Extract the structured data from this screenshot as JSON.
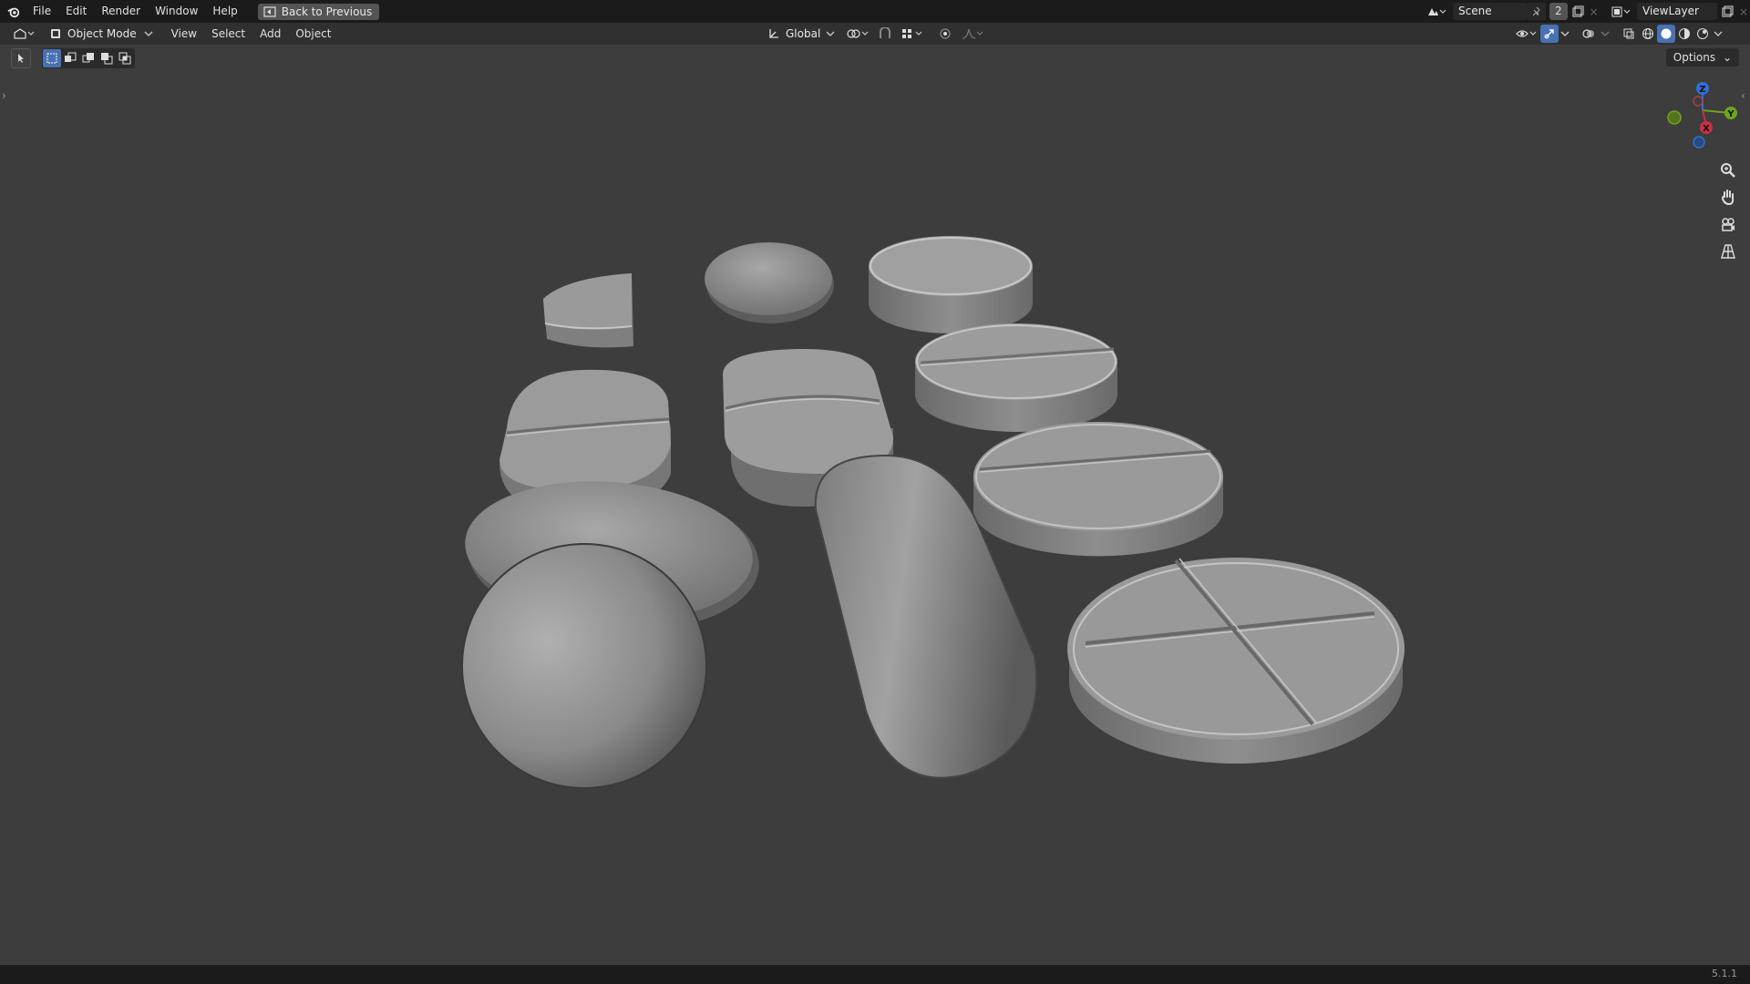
{
  "topbar": {
    "menu": [
      "File",
      "Edit",
      "Render",
      "Window",
      "Help"
    ],
    "back_button": "Back to Previous",
    "scene_name": "Scene",
    "scene_users": "2",
    "view_layer": "ViewLayer"
  },
  "header": {
    "mode": "Object Mode",
    "menu": [
      "View",
      "Select",
      "Add",
      "Object"
    ],
    "transform_orientation": "Global"
  },
  "viewport": {
    "options_label": "Options",
    "gizmo": {
      "x": "X",
      "y": "Y",
      "z": "Z"
    },
    "object_type": "pill and tablet meshes",
    "shading": "solid"
  },
  "statusbar": {
    "version": "5.1.1"
  },
  "colors": {
    "accent": "#4772b3",
    "bg": "#3d3d3d",
    "topbar": "#1b1b1b",
    "header": "#303030"
  }
}
